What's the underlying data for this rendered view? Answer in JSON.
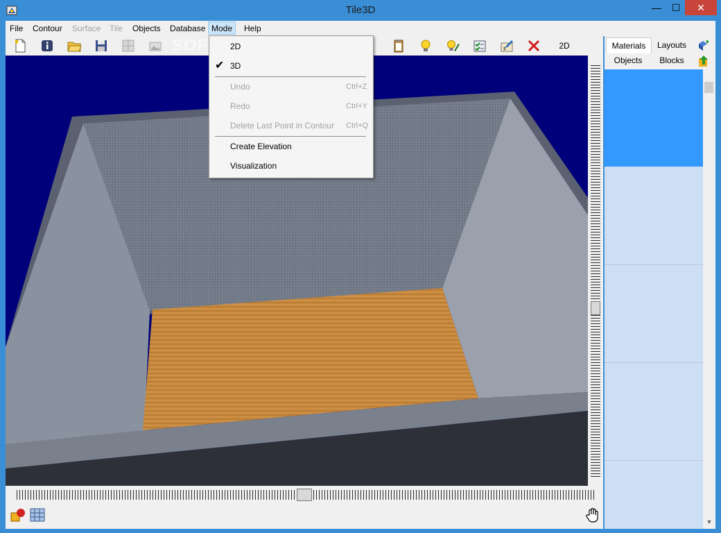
{
  "window": {
    "title": "Tile3D",
    "min_glyph": "—",
    "max_glyph": "☐",
    "close_glyph": "✕"
  },
  "menubar": {
    "items": [
      {
        "label": "File",
        "enabled": true
      },
      {
        "label": "Contour",
        "enabled": true
      },
      {
        "label": "Surface",
        "enabled": false
      },
      {
        "label": "Tile",
        "enabled": false
      },
      {
        "label": "Objects",
        "enabled": true
      },
      {
        "label": "Database",
        "enabled": true
      },
      {
        "label": "Mode",
        "enabled": true,
        "open": true
      },
      {
        "label": "Help",
        "enabled": true
      }
    ]
  },
  "toolbar": {
    "icons": [
      "new-document-icon",
      "info-icon",
      "open-folder-icon",
      "save-icon",
      "grid-icon",
      "import-image-icon",
      "clipboard-icon",
      "lightbulb-icon",
      "lightbulb-pencil-icon",
      "checklist-icon",
      "calculator-icon",
      "delete-x-icon"
    ],
    "mode_label": "2D",
    "watermark": "SOFTPEDIA"
  },
  "mode_menu": {
    "items": [
      {
        "label": "2D",
        "shortcut": "",
        "checked": false,
        "enabled": true
      },
      {
        "label": "3D",
        "shortcut": "",
        "checked": true,
        "enabled": true
      },
      {
        "label": "Undo",
        "shortcut": "Ctrl+Z",
        "checked": false,
        "enabled": false
      },
      {
        "label": "Redo",
        "shortcut": "Ctrl+Y",
        "checked": false,
        "enabled": false
      },
      {
        "label": "Delete Last Point in Contour",
        "shortcut": "Ctrl+Q",
        "checked": false,
        "enabled": false
      },
      {
        "label": "Create Elevation",
        "shortcut": "",
        "checked": false,
        "enabled": true
      },
      {
        "label": "Visualization",
        "shortcut": "",
        "checked": false,
        "enabled": true
      }
    ],
    "check_glyph": "✔"
  },
  "right_panel": {
    "tabs_row1": [
      "Materials",
      "Layouts"
    ],
    "tabs_row2": [
      "Objects",
      "Blocks"
    ],
    "active_tab": "Materials",
    "scroll_down_glyph": "▼"
  },
  "colors": {
    "titlebar": "#3a8ed5",
    "sky": "#00007a",
    "wall": "#6d7584",
    "floor": "#c8893e",
    "selection": "#3399ff",
    "list_bg": "#ccdff4"
  }
}
